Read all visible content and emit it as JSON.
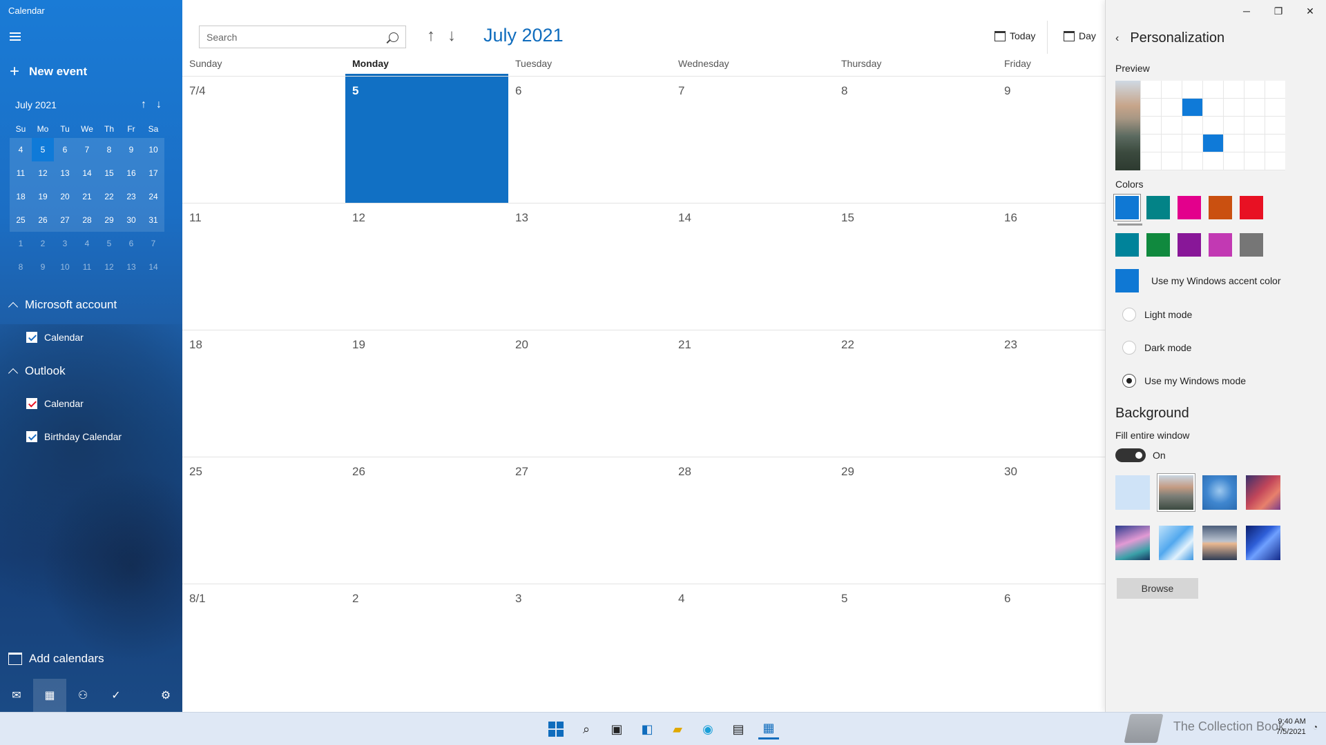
{
  "app": {
    "title": "Calendar"
  },
  "sidebar": {
    "new_event": "New event",
    "mini_month": "July 2021",
    "dow": [
      "Su",
      "Mo",
      "Tu",
      "We",
      "Th",
      "Fr",
      "Sa"
    ],
    "weeks": [
      [
        "4",
        "5",
        "6",
        "7",
        "8",
        "9",
        "10"
      ],
      [
        "11",
        "12",
        "13",
        "14",
        "15",
        "16",
        "17"
      ],
      [
        "18",
        "19",
        "20",
        "21",
        "22",
        "23",
        "24"
      ],
      [
        "25",
        "26",
        "27",
        "28",
        "29",
        "30",
        "31"
      ],
      [
        "1",
        "2",
        "3",
        "4",
        "5",
        "6",
        "7"
      ],
      [
        "8",
        "9",
        "10",
        "11",
        "12",
        "13",
        "14"
      ]
    ],
    "accounts": [
      {
        "name": "Microsoft account",
        "calendars": [
          {
            "label": "Calendar",
            "color": "#ffffff"
          }
        ]
      },
      {
        "name": "Outlook",
        "calendars": [
          {
            "label": "Calendar",
            "color": "#e81123"
          },
          {
            "label": "Birthday Calendar",
            "color": "#ffffff"
          }
        ]
      }
    ],
    "add_calendars": "Add calendars"
  },
  "toolbar": {
    "search_placeholder": "Search",
    "month_title": "July 2021",
    "today": "Today",
    "day": "Day"
  },
  "month_view": {
    "day_names": [
      "Sunday",
      "Monday",
      "Tuesday",
      "Wednesday",
      "Thursday",
      "Friday"
    ],
    "active_day": "Monday",
    "weeks": [
      [
        "7/4",
        "5",
        "6",
        "7",
        "8",
        "9"
      ],
      [
        "11",
        "12",
        "13",
        "14",
        "15",
        "16"
      ],
      [
        "18",
        "19",
        "20",
        "21",
        "22",
        "23"
      ],
      [
        "25",
        "26",
        "27",
        "28",
        "29",
        "30"
      ],
      [
        "8/1",
        "2",
        "3",
        "4",
        "5",
        "6"
      ]
    ],
    "today": "5"
  },
  "personalization": {
    "title": "Personalization",
    "preview_label": "Preview",
    "colors_label": "Colors",
    "colors_row1": [
      "#0f78d4",
      "#038387",
      "#e3008c",
      "#ca5010",
      "#e81123"
    ],
    "colors_row2": [
      "#00839a",
      "#10893e",
      "#881798",
      "#c239b3",
      "#767676"
    ],
    "accent_color": "#0f78d4",
    "accent_label": "Use my Windows accent color",
    "modes": [
      {
        "label": "Light mode",
        "selected": false
      },
      {
        "label": "Dark mode",
        "selected": false
      },
      {
        "label": "Use my Windows mode",
        "selected": true
      }
    ],
    "background_title": "Background",
    "fill_label": "Fill entire window",
    "toggle_state": "On",
    "browse": "Browse"
  },
  "taskbar": {
    "time": "9:40 AM",
    "date": "7/5/2021",
    "watermark": "The Collection Book"
  }
}
